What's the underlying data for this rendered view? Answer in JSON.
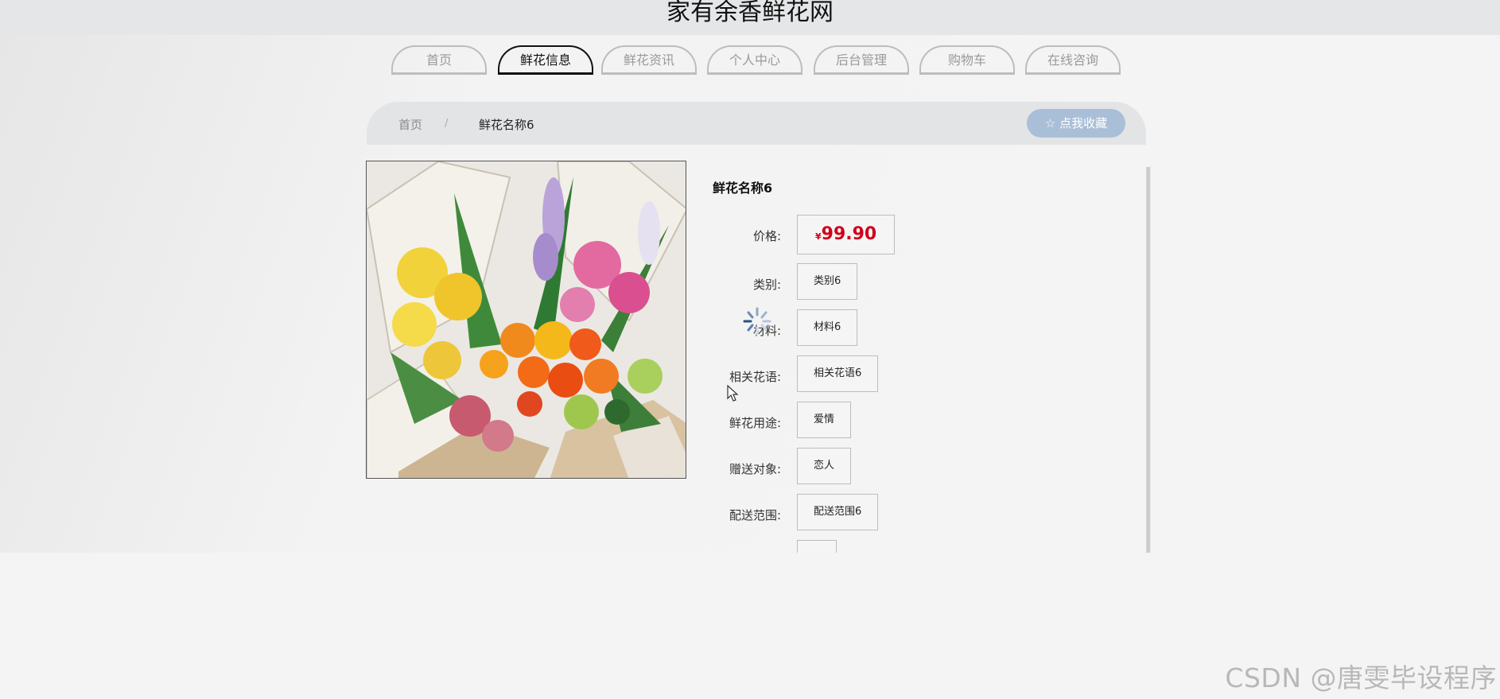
{
  "header": {
    "title": "家有余香鲜花网"
  },
  "nav": {
    "tabs": [
      {
        "label": "首页",
        "active": false
      },
      {
        "label": "鲜花信息",
        "active": true
      },
      {
        "label": "鲜花资讯",
        "active": false
      },
      {
        "label": "个人中心",
        "active": false
      },
      {
        "label": "后台管理",
        "active": false
      },
      {
        "label": "购物车",
        "active": false
      },
      {
        "label": "在线咨询",
        "active": false
      }
    ]
  },
  "breadcrumb": {
    "home": "首页",
    "separator": "/",
    "current": "鲜花名称6"
  },
  "favorite": {
    "icon": "star-outline-icon",
    "label": "☆ 点我收藏"
  },
  "product": {
    "image_icon": "flower-bouquet-image",
    "name": "鲜花名称6",
    "price": {
      "label": "价格:",
      "currency": "¥",
      "value": "99.90"
    },
    "fields": [
      {
        "label": "类别:",
        "value": "类别6"
      },
      {
        "label": "材料:",
        "value": "材料6"
      },
      {
        "label": "相关花语:",
        "value": "相关花语6"
      },
      {
        "label": "鲜花用途:",
        "value": "爱情"
      },
      {
        "label": "赠送对象:",
        "value": "恋人"
      },
      {
        "label": "配送范围:",
        "value": "配送范围6"
      }
    ]
  },
  "overlay": {
    "loading_icon": "loading-spinner-icon",
    "cursor_icon": "mouse-cursor-icon"
  },
  "colors": {
    "price": "#d0021b",
    "favorite_button": "#a9bfd8",
    "active_tab": "#111111"
  },
  "watermark": {
    "text": "CSDN @唐雯毕设程序"
  }
}
